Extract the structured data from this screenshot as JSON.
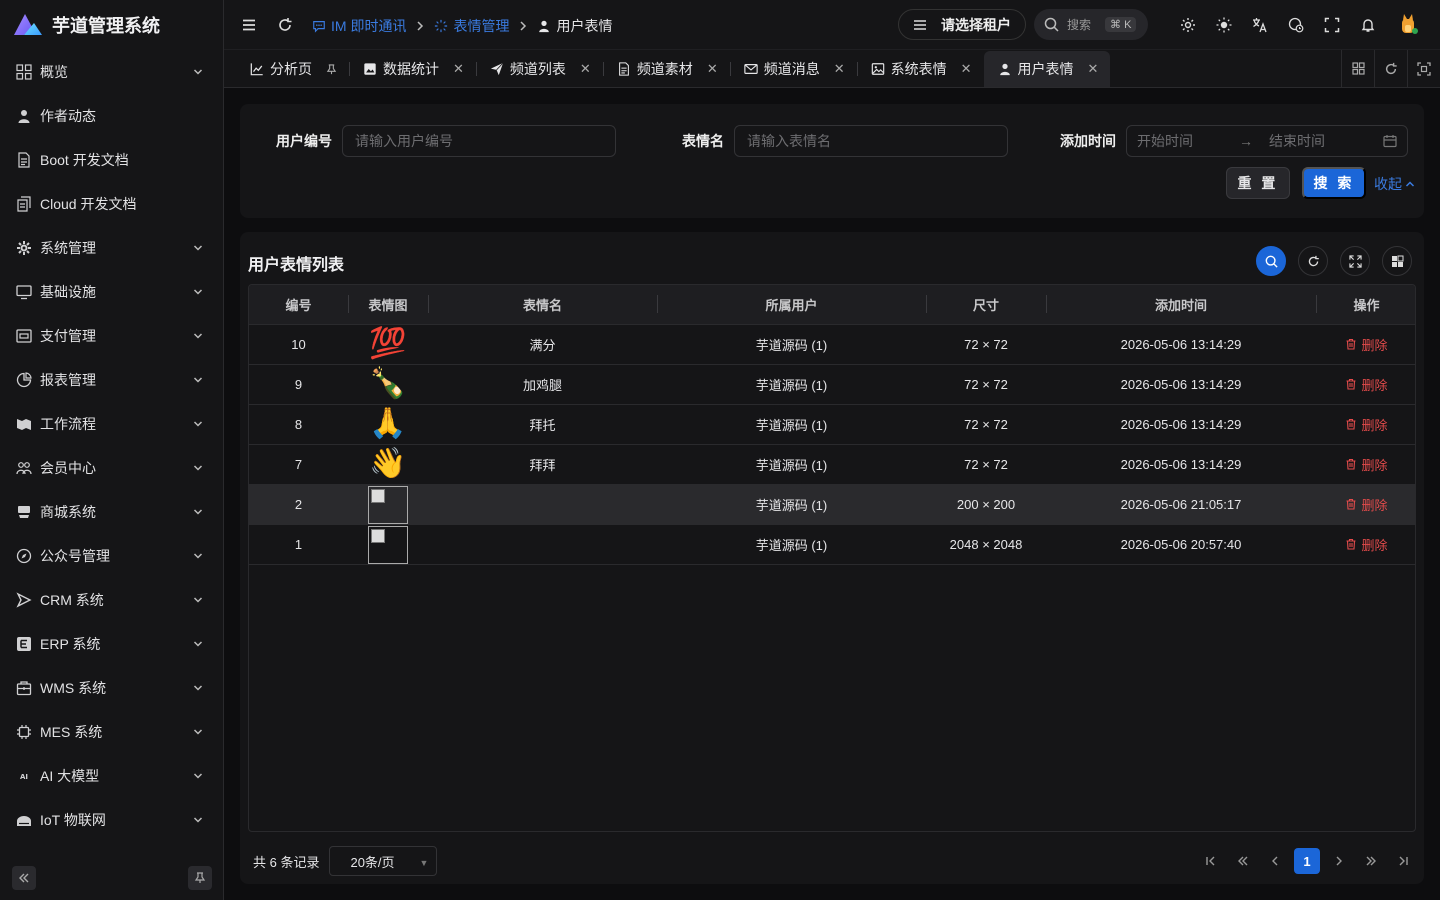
{
  "app": {
    "title": "芋道管理系统"
  },
  "sidebar": {
    "items": [
      {
        "label": "概览",
        "icon": "dashboard-icon",
        "expandable": true
      },
      {
        "label": "作者动态",
        "icon": "user-icon",
        "expandable": false
      },
      {
        "label": "Boot 开发文档",
        "icon": "document-icon",
        "expandable": false
      },
      {
        "label": "Cloud 开发文档",
        "icon": "document-copy-icon",
        "expandable": false
      },
      {
        "label": "系统管理",
        "icon": "gear-icon",
        "expandable": true
      },
      {
        "label": "基础设施",
        "icon": "monitor-icon",
        "expandable": true
      },
      {
        "label": "支付管理",
        "icon": "wallet-icon",
        "expandable": true
      },
      {
        "label": "报表管理",
        "icon": "pie-chart-icon",
        "expandable": true
      },
      {
        "label": "工作流程",
        "icon": "flow-icon",
        "expandable": true
      },
      {
        "label": "会员中心",
        "icon": "members-icon",
        "expandable": true
      },
      {
        "label": "商城系统",
        "icon": "shop-icon",
        "expandable": true
      },
      {
        "label": "公众号管理",
        "icon": "compass-icon",
        "expandable": true
      },
      {
        "label": "CRM 系统",
        "icon": "triangle-icon",
        "expandable": true
      },
      {
        "label": "ERP 系统",
        "icon": "erp-icon",
        "expandable": true
      },
      {
        "label": "WMS 系统",
        "icon": "package-icon",
        "expandable": true
      },
      {
        "label": "MES 系统",
        "icon": "chip-icon",
        "expandable": true
      },
      {
        "label": "AI 大模型",
        "icon": "ai-icon",
        "expandable": true
      },
      {
        "label": "IoT 物联网",
        "icon": "router-icon",
        "expandable": true
      }
    ]
  },
  "breadcrumb": [
    {
      "label": "IM 即时通讯",
      "icon": "chat-icon",
      "link": true
    },
    {
      "label": "表情管理",
      "icon": "sparkle-icon",
      "link": true
    },
    {
      "label": "用户表情",
      "icon": "user-icon",
      "link": false
    }
  ],
  "header": {
    "tenant": "请选择租户",
    "search_label": "搜索",
    "search_shortcut": "⌘ K"
  },
  "tabs": [
    {
      "label": "分析页",
      "icon": "chart-icon",
      "closable": false,
      "pinned": true,
      "active": false
    },
    {
      "label": "数据统计",
      "icon": "image-box-icon",
      "closable": true,
      "active": false
    },
    {
      "label": "频道列表",
      "icon": "send-icon",
      "closable": true,
      "active": false
    },
    {
      "label": "频道素材",
      "icon": "document-icon",
      "closable": true,
      "active": false
    },
    {
      "label": "频道消息",
      "icon": "mail-icon",
      "closable": true,
      "active": false
    },
    {
      "label": "系统表情",
      "icon": "picture-icon",
      "closable": true,
      "active": false
    },
    {
      "label": "用户表情",
      "icon": "user-icon",
      "closable": true,
      "active": true
    }
  ],
  "filter": {
    "user_id_label": "用户编号",
    "user_id_placeholder": "请输入用户编号",
    "name_label": "表情名",
    "name_placeholder": "请输入表情名",
    "time_label": "添加时间",
    "start_placeholder": "开始时间",
    "end_placeholder": "结束时间",
    "reset_label": "重 置",
    "search_label": "搜 索",
    "collapse_label": "收起"
  },
  "table": {
    "title": "用户表情列表",
    "columns": [
      "编号",
      "表情图",
      "表情名",
      "所属用户",
      "尺寸",
      "添加时间",
      "操作"
    ],
    "rows": [
      {
        "id": "10",
        "image": "💯",
        "name": "满分",
        "user": "芋道源码 (1)",
        "size": "72 × 72",
        "time": "2026-05-06 13:14:29",
        "action": "删除",
        "broken": false
      },
      {
        "id": "9",
        "image": "🍾",
        "name": "加鸡腿",
        "user": "芋道源码 (1)",
        "size": "72 × 72",
        "time": "2026-05-06 13:14:29",
        "action": "删除",
        "broken": false
      },
      {
        "id": "8",
        "image": "🙏",
        "name": "拜托",
        "user": "芋道源码 (1)",
        "size": "72 × 72",
        "time": "2026-05-06 13:14:29",
        "action": "删除",
        "broken": false
      },
      {
        "id": "7",
        "image": "👋",
        "name": "拜拜",
        "user": "芋道源码 (1)",
        "size": "72 × 72",
        "time": "2026-05-06 13:14:29",
        "action": "删除",
        "broken": false
      },
      {
        "id": "2",
        "image": "",
        "name": "",
        "user": "芋道源码 (1)",
        "size": "200 × 200",
        "time": "2026-05-06 21:05:17",
        "action": "删除",
        "broken": true,
        "hover": true
      },
      {
        "id": "1",
        "image": "",
        "name": "",
        "user": "芋道源码 (1)",
        "size": "2048 × 2048",
        "time": "2026-05-06 20:57:40",
        "action": "删除",
        "broken": true
      }
    ]
  },
  "pagination": {
    "total_text": "共 6 条记录",
    "page_size": "20条/页",
    "current_page": "1"
  },
  "colors": {
    "accent": "#1b66d8",
    "link": "#3a7be0",
    "danger": "#e34b4b"
  }
}
